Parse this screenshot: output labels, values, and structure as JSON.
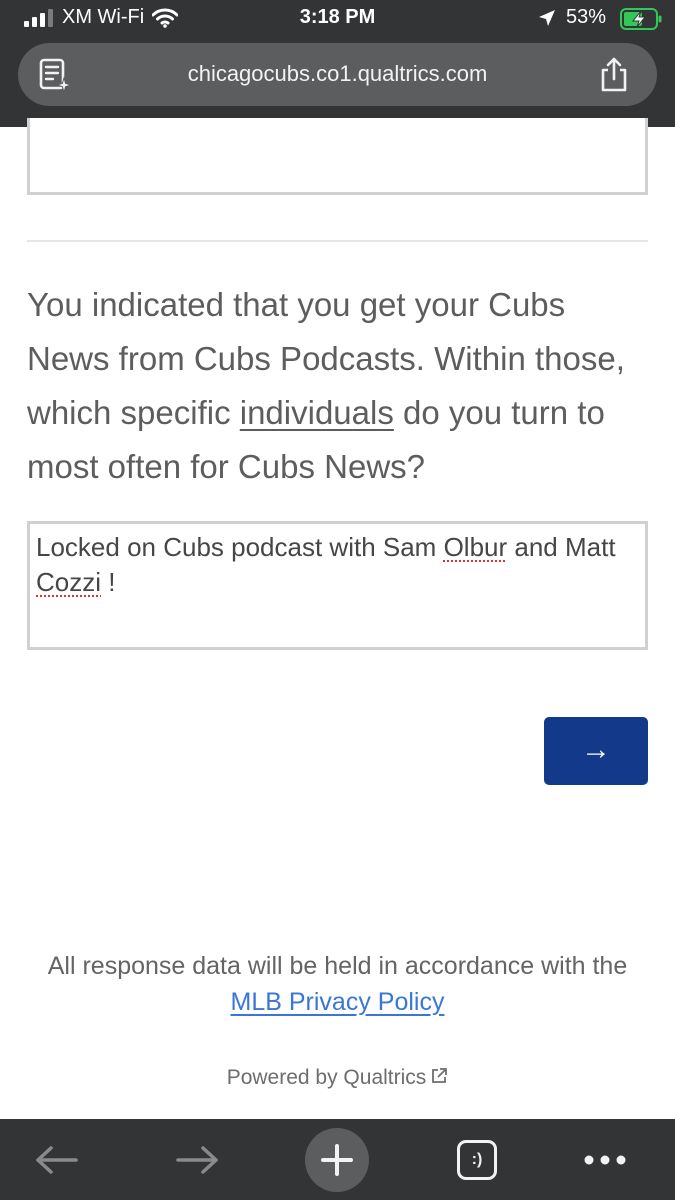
{
  "status_bar": {
    "carrier": "XM Wi-Fi",
    "time": "3:18 PM",
    "battery_percent": "53%",
    "signal_bars_filled": 3,
    "signal_bars_total": 4,
    "battery_level": 0.53,
    "icons": [
      "signal-icon",
      "wifi-icon",
      "location-arrow-icon",
      "battery-charging-icon"
    ]
  },
  "browser": {
    "url": "chicagocubs.co1.qualtrics.com",
    "icons": [
      "reader-mode-icon",
      "share-icon"
    ]
  },
  "survey": {
    "question_part1": "You indicated that you get your Cubs News from Cubs Podcasts. Within those, which specific",
    "question_emphasis": "individuals",
    "question_part2": "do you turn to most often for Cubs News?",
    "answer_part1": "Locked on Cubs podcast with Sam",
    "answer_misspelled_1": "Olbur",
    "answer_part2": "and Matt",
    "answer_misspelled_2": "Cozzi",
    "answer_part3": "!",
    "next_button_label": "→"
  },
  "footer": {
    "notice_text": "All response data will be held in accordance with the",
    "privacy_link_label": "MLB Privacy Policy",
    "powered_by": "Powered by Qualtrics"
  },
  "toolbar": {
    "tabs_label": ":)",
    "icons": [
      "back-arrow-icon",
      "forward-arrow-icon",
      "plus-icon",
      "tabs-icon",
      "more-icon"
    ]
  },
  "colors": {
    "chrome_bg": "#333435",
    "url_bar_bg": "#5b5d5f",
    "next_button": "#12398a",
    "link": "#3a76d9",
    "spellcheck": "#e0312f",
    "battery_charge": "#33c759"
  }
}
